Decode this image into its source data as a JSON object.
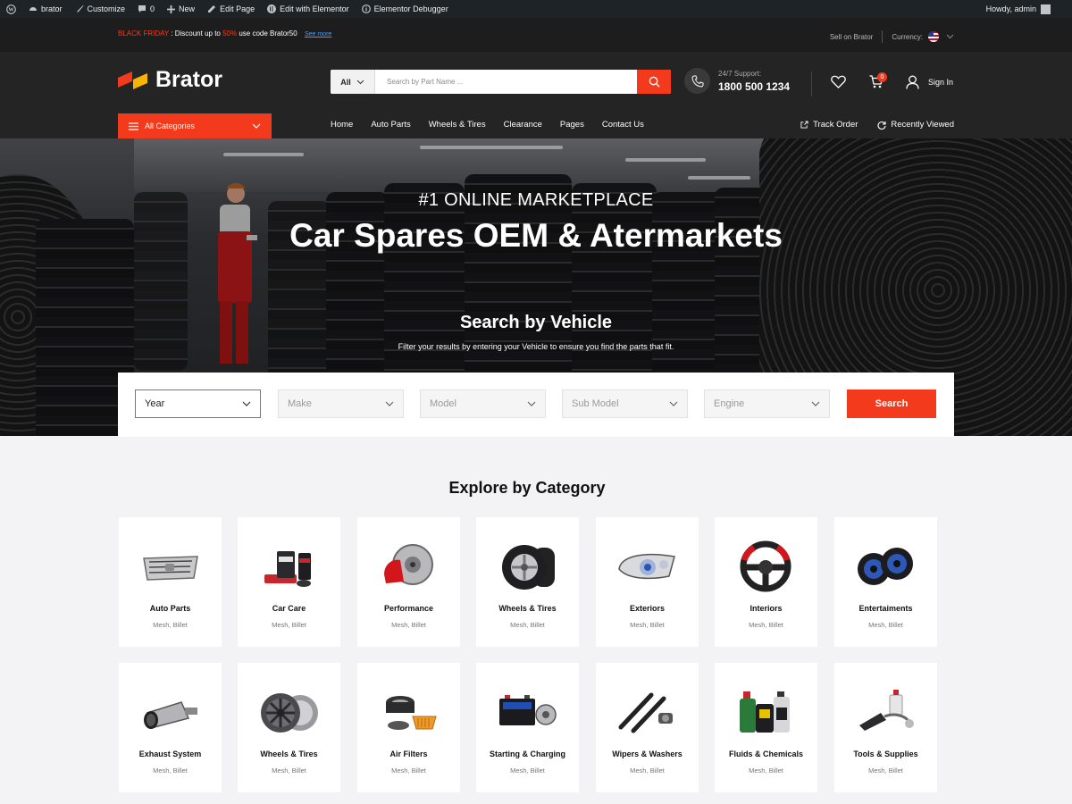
{
  "admin_bar": {
    "site": "brator",
    "customize": "Customize",
    "comments": "0",
    "new": "New",
    "edit_page": "Edit Page",
    "edit_elementor": "Edit with Elementor",
    "debugger": "Elementor Debugger",
    "howdy": "Howdy, admin"
  },
  "topbar": {
    "promo_label": "BLACK FRIDAY",
    "promo_text_1": " : Discount up to ",
    "promo_percent": "50%",
    "promo_text_2": " use code Brator50",
    "see_more": "See more",
    "sell": "Sell on Brator",
    "currency_label": "Currency:"
  },
  "header": {
    "logo": "Brator",
    "search_category": "All",
    "search_placeholder": "Search by Part Name ...",
    "support_label": "24/7 Support:",
    "support_phone": "1800 500 1234",
    "cart_count": "0",
    "sign_in": "Sign In",
    "all_categories": "All Categories",
    "nav": [
      "Home",
      "Auto Parts",
      "Wheels & Tires",
      "Clearance",
      "Pages",
      "Contact Us"
    ],
    "track_order": "Track Order",
    "recently_viewed": "Recently Viewed"
  },
  "hero": {
    "kicker": "#1 ONLINE MARKETPLACE",
    "title": "Car Spares OEM & Atermarkets",
    "search_title": "Search by Vehicle",
    "search_subtitle": "Filter your results by entering your Vehicle to ensure you find the parts that fit."
  },
  "vehicle_search": {
    "fields": [
      "Year",
      "Make",
      "Model",
      "Sub Model",
      "Engine"
    ],
    "button": "Search"
  },
  "categories": {
    "title": "Explore by Category",
    "items": [
      {
        "name": "Auto Parts",
        "sub": "Mesh,  Billet",
        "icon": "grille-icon"
      },
      {
        "name": "Car Care",
        "sub": "Mesh,  Billet",
        "icon": "car-care-kit-icon"
      },
      {
        "name": "Performance",
        "sub": "Mesh,  Billet",
        "icon": "brake-disc-icon"
      },
      {
        "name": "Wheels & Tires",
        "sub": "Mesh,  Billet",
        "icon": "tire-icon"
      },
      {
        "name": "Exteriors",
        "sub": "Mesh,  Billet",
        "icon": "headlight-icon"
      },
      {
        "name": "Interiors",
        "sub": "Mesh,  Billet",
        "icon": "steering-wheel-icon"
      },
      {
        "name": "Entertaiments",
        "sub": "Mesh,  Billet",
        "icon": "speaker-icon"
      },
      {
        "name": "Exhaust System",
        "sub": "Mesh,  Billet",
        "icon": "exhaust-icon"
      },
      {
        "name": "Wheels & Tires",
        "sub": "Mesh,  Billet",
        "icon": "rim-icon"
      },
      {
        "name": "Air Filters",
        "sub": "Mesh,  Billet",
        "icon": "air-filter-icon"
      },
      {
        "name": "Starting & Charging",
        "sub": "Mesh,  Billet",
        "icon": "battery-icon"
      },
      {
        "name": "Wipers & Washers",
        "sub": "Mesh,  Billet",
        "icon": "wiper-icon"
      },
      {
        "name": "Fluids & Chemicals",
        "sub": "Mesh,  Billet",
        "icon": "oil-bottle-icon"
      },
      {
        "name": "Tools & Supplies",
        "sub": "Mesh,  Billet",
        "icon": "tools-icon"
      }
    ]
  },
  "colors": {
    "accent": "#f33a1d",
    "dark": "#242424",
    "topbar": "#1d1d1d",
    "admin_bar": "#1d2327",
    "page_bg": "#f3f3f6"
  }
}
